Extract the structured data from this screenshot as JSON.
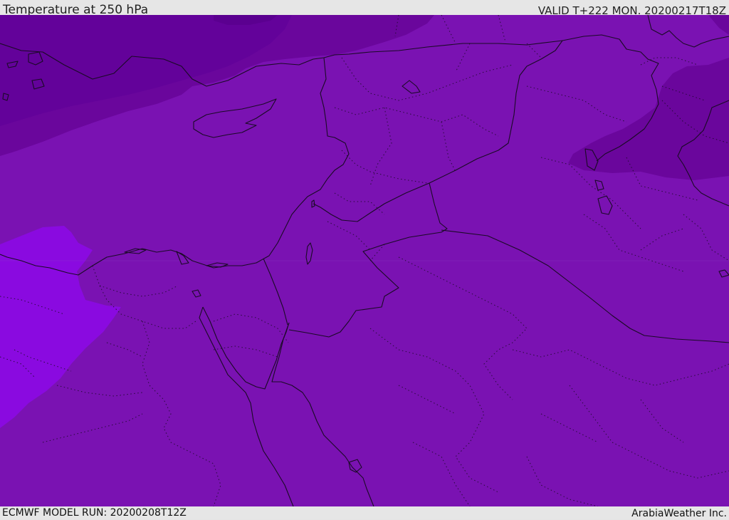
{
  "header": {
    "title": "Temperature at 250 hPa",
    "valid": "VALID T+222 MON. 20200217T18Z"
  },
  "footer": {
    "model_run": "ECMWF MODEL RUN: 20200208T12Z",
    "credit": "ArabiaWeather Inc."
  },
  "colors": {
    "base": "#7a12b2",
    "cold_region": "#6a069c",
    "colder_region": "#5f008f",
    "warm_region": "#8a0ae0",
    "border": "#1a0a25",
    "bar": "#e6e6e6"
  }
}
